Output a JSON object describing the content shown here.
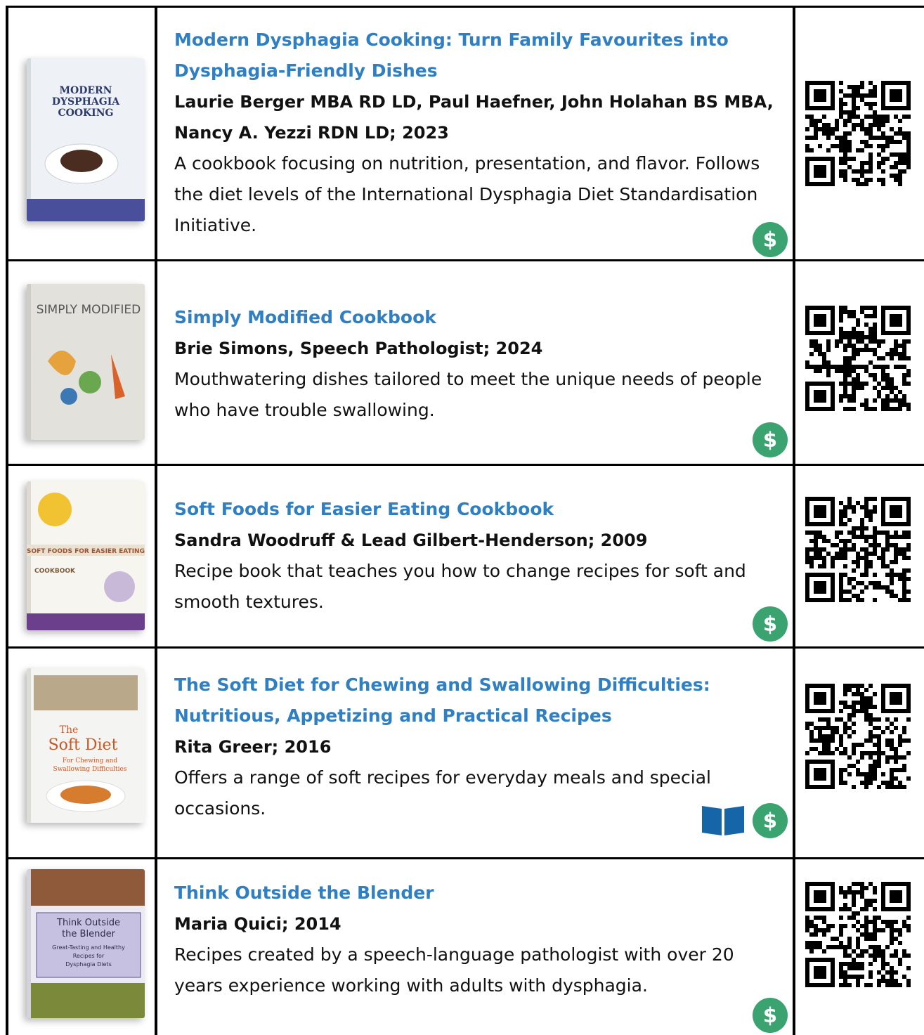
{
  "books": [
    {
      "title": "Modern Dysphagia Cooking: Turn Family Favourites into Dysphagia-Friendly Dishes",
      "authors": "Laurie Berger MBA RD LD, Paul Haefner, John Holahan BS MBA, Nancy A. Yezzi RDN LD; 2023",
      "description": "A cookbook focusing on nutrition, presentation, and flavor. Follows the diet levels of the International Dysphagia Diet Standardisation Initiative.",
      "cover_text": [
        "MODERN",
        "DYSPHAGIA",
        "COOKING"
      ],
      "price_icon": "$",
      "has_ebook": false
    },
    {
      "title": "Simply Modified Cookbook",
      "authors": "Brie Simons, Speech Pathologist; 2024",
      "description": "Mouthwatering dishes tailored to meet the unique needs of people who have trouble swallowing.",
      "cover_text": [
        "SIMPLY MODIFIED"
      ],
      "price_icon": "$",
      "has_ebook": false
    },
    {
      "title": "Soft Foods for Easier Eating Cookbook",
      "authors": "Sandra Woodruff & Lead Gilbert-Henderson; 2009",
      "description": "Recipe book that teaches you how to change recipes for soft and smooth textures.",
      "cover_text": [
        "SOFT FOODS FOR EASIER EATING",
        "COOKBOOK"
      ],
      "price_icon": "$",
      "has_ebook": false
    },
    {
      "title": "The Soft Diet for Chewing and Swallowing Difficulties: Nutritious, Appetizing and Practical Recipes",
      "authors": "Rita Greer; 2016",
      "description": "Offers a range of soft recipes for everyday meals and special occasions.",
      "cover_text": [
        "The",
        "Soft Diet",
        "For Chewing and",
        "Swallowing Difficulties"
      ],
      "price_icon": "$",
      "has_ebook": true
    },
    {
      "title": "Think Outside the Blender",
      "authors": "Maria Quici; 2014",
      "description": "Recipes created by a speech-language pathologist with over 20 years experience working with adults with dysphagia.",
      "cover_text": [
        "Think Outside",
        "the Blender",
        "Great-Tasting and Healthy",
        "Recipes for",
        "Dysphagia Diets"
      ],
      "price_icon": "$",
      "has_ebook": false
    }
  ],
  "colors": {
    "title": "#2f7fc2",
    "price_badge": "#3aa36f",
    "ebook_icon": "#1565a8",
    "grid": "#000000"
  },
  "icons": {
    "price": "dollar-icon",
    "ebook": "open-book-icon",
    "qr": "qr-code-icon"
  }
}
